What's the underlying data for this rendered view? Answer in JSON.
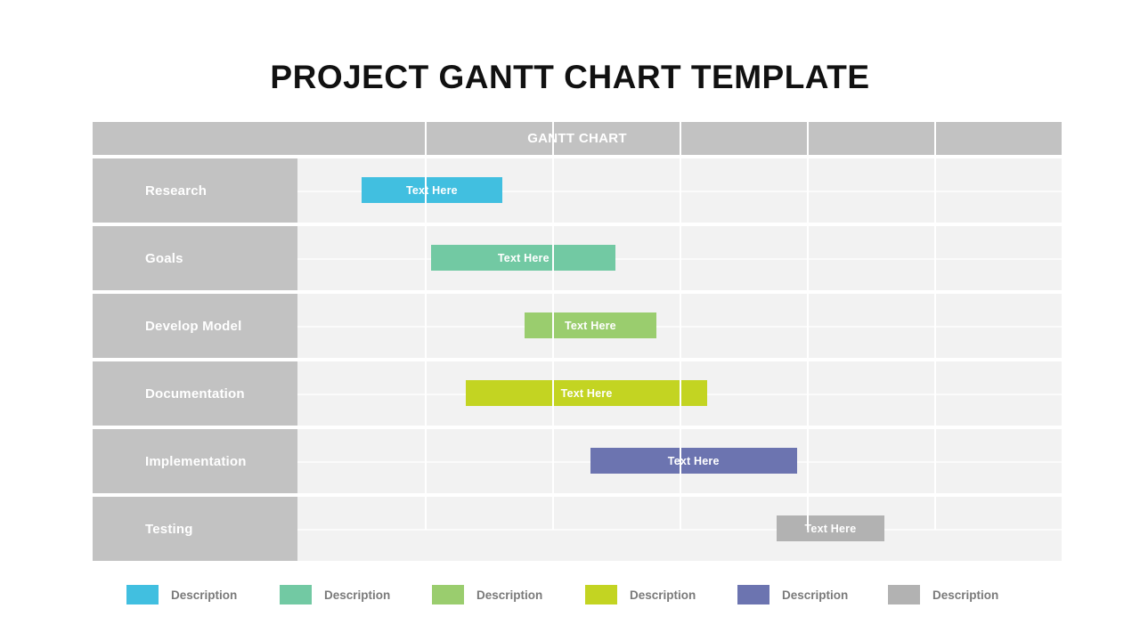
{
  "title": "PROJECT GANTT CHART TEMPLATE",
  "header": {
    "label": "GANTT CHART"
  },
  "legend": {
    "items": [
      {
        "label": "Description",
        "color": "#41bfe0"
      },
      {
        "label": "Description",
        "color": "#72c9a3"
      },
      {
        "label": "Description",
        "color": "#9acd6e"
      },
      {
        "label": "Description",
        "color": "#c3d422"
      },
      {
        "label": "Description",
        "color": "#6c74b0"
      },
      {
        "label": "Description",
        "color": "#b2b2b2"
      }
    ]
  },
  "chart_data": {
    "type": "bar",
    "title": "GANTT CHART",
    "xlabel": "",
    "ylabel": "",
    "orientation": "horizontal",
    "grid": true,
    "legend_position": "bottom",
    "x_axis": {
      "min": 0,
      "max": 6,
      "gridlines": [
        1,
        2,
        3,
        4,
        5
      ]
    },
    "categories": [
      "Research",
      "Goals",
      "Develop Model",
      "Documentation",
      "Implementation",
      "Testing"
    ],
    "bar_label": "Text Here",
    "tasks": [
      {
        "name": "Research",
        "label": "Text Here",
        "start": 0.5,
        "end": 1.61,
        "color": "#41bfe0"
      },
      {
        "name": "Goals",
        "label": "Text Here",
        "start": 1.05,
        "end": 2.5,
        "color": "#72c9a3"
      },
      {
        "name": "Develop Model",
        "label": "Text Here",
        "start": 1.78,
        "end": 2.82,
        "color": "#9acd6e"
      },
      {
        "name": "Documentation",
        "label": "Text Here",
        "start": 1.32,
        "end": 3.22,
        "color": "#c3d422"
      },
      {
        "name": "Implementation",
        "label": "Text Here",
        "start": 2.3,
        "end": 3.92,
        "color": "#6c74b0"
      },
      {
        "name": "Testing",
        "label": "Text Here",
        "start": 3.76,
        "end": 4.61,
        "color": "#b2b2b2"
      }
    ]
  },
  "colors": {
    "label_column": "#c2c2c2",
    "header_band": "#c2c2c2",
    "plot_background": "#f2f2f2",
    "gridline": "#ffffff",
    "title_text": "#111111",
    "legend_text": "#7a7a7a"
  }
}
